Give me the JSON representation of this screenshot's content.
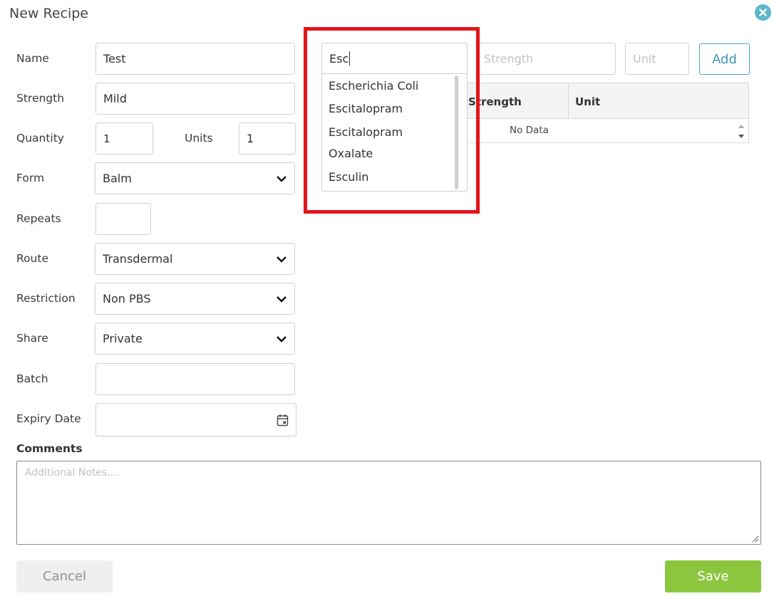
{
  "dialog": {
    "title": "New Recipe",
    "close_icon": "close-icon",
    "accent": "#5bb5cc"
  },
  "form": {
    "name": {
      "label": "Name",
      "value": "Test"
    },
    "strength": {
      "label": "Strength",
      "value": "Mild"
    },
    "quantity": {
      "label": "Quantity",
      "value": "1"
    },
    "units": {
      "label": "Units",
      "value": "1"
    },
    "form": {
      "label": "Form",
      "value": "Balm"
    },
    "repeats": {
      "label": "Repeats",
      "value": ""
    },
    "route": {
      "label": "Route",
      "value": "Transdermal"
    },
    "restriction": {
      "label": "Restriction",
      "value": "Non PBS"
    },
    "share": {
      "label": "Share",
      "value": "Private"
    },
    "batch": {
      "label": "Batch",
      "value": ""
    },
    "expiry": {
      "label": "Expiry Date",
      "value": "",
      "icon": "calendar-icon"
    }
  },
  "ingredient": {
    "search_value": "Esc",
    "suggestions": [
      "Escherichia Coli",
      "Escitalopram",
      "Escitalopram",
      "Oxalate",
      "Esculin"
    ],
    "strength_placeholder": "Strength",
    "unit_placeholder": "Unit",
    "add_label": "Add",
    "highlight_color": "#e5131b"
  },
  "grid": {
    "columns": [
      "Strength",
      "Unit"
    ],
    "empty_text": "No Data"
  },
  "comments": {
    "label": "Comments",
    "placeholder": "Additional Notes...."
  },
  "actions": {
    "cancel_label": "Cancel",
    "save_label": "Save",
    "save_color": "#8cc63e"
  }
}
